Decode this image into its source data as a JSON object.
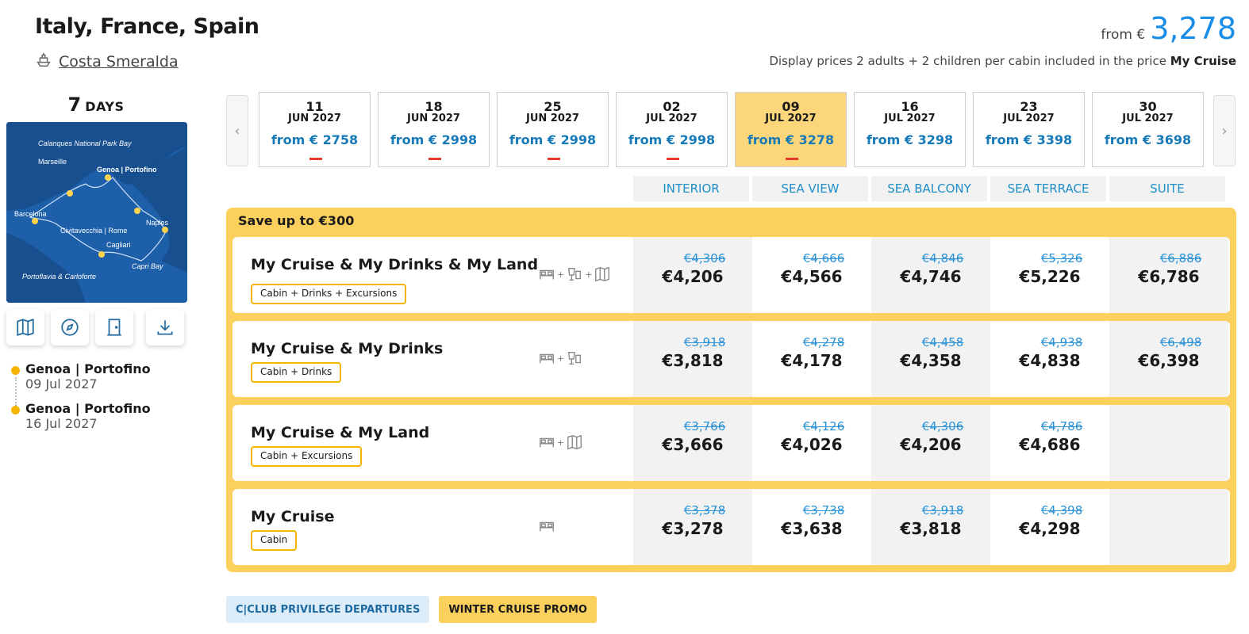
{
  "header": {
    "title": "Italy, France, Spain",
    "ship": "Costa Smeralda",
    "from_label": "from €",
    "price": "3,278",
    "note_prefix": "Display prices 2 adults + 2 children per cabin included in the price",
    "note_bold": "My Cruise"
  },
  "duration": {
    "number": "7",
    "unit": "DAYS"
  },
  "map": {
    "labels": [
      "Calanques National Park Bay",
      "Marseille",
      "Genoa | Portofino",
      "Barcelona",
      "Naples",
      "Civitavecchia | Rome",
      "Cagliari",
      "Capri Bay",
      "Portoflavia & Carloforte"
    ]
  },
  "map_actions": [
    "map-icon",
    "compass-icon",
    "door-icon",
    "download-icon"
  ],
  "itinerary": [
    {
      "port": "Genoa | Portofino",
      "date": "09 Jul 2027"
    },
    {
      "port": "Genoa | Portofino",
      "date": "16 Jul 2027"
    }
  ],
  "dates": [
    {
      "day": "11",
      "month": "JUN 2027",
      "price": "from € 2758",
      "dash": true,
      "selected": false
    },
    {
      "day": "18",
      "month": "JUN 2027",
      "price": "from € 2998",
      "dash": true,
      "selected": false
    },
    {
      "day": "25",
      "month": "JUN 2027",
      "price": "from € 2998",
      "dash": true,
      "selected": false
    },
    {
      "day": "02",
      "month": "JUL 2027",
      "price": "from € 2998",
      "dash": true,
      "selected": false
    },
    {
      "day": "09",
      "month": "JUL 2027",
      "price": "from € 3278",
      "dash": true,
      "selected": true
    },
    {
      "day": "16",
      "month": "JUL 2027",
      "price": "from € 3298",
      "dash": false,
      "selected": false
    },
    {
      "day": "23",
      "month": "JUL 2027",
      "price": "from € 3398",
      "dash": false,
      "selected": false
    },
    {
      "day": "30",
      "month": "JUL 2027",
      "price": "from € 3698",
      "dash": false,
      "selected": false
    }
  ],
  "categories": [
    "INTERIOR",
    "SEA VIEW",
    "SEA BALCONY",
    "SEA TERRACE",
    "SUITE"
  ],
  "offer": {
    "save": "Save up to €300",
    "rows": [
      {
        "name": "My Cruise & My Drinks & My Land",
        "tag": "Cabin + Drinks + Excursions",
        "prices": [
          [
            "€4,306",
            "€4,206"
          ],
          [
            "€4,666",
            "€4,566"
          ],
          [
            "€4,846",
            "€4,746"
          ],
          [
            "€5,326",
            "€5,226"
          ],
          [
            "€6,886",
            "€6,786"
          ]
        ]
      },
      {
        "name": "My Cruise & My Drinks",
        "tag": "Cabin + Drinks",
        "prices": [
          [
            "€3,918",
            "€3,818"
          ],
          [
            "€4,278",
            "€4,178"
          ],
          [
            "€4,458",
            "€4,358"
          ],
          [
            "€4,938",
            "€4,838"
          ],
          [
            "€6,498",
            "€6,398"
          ]
        ]
      },
      {
        "name": "My Cruise & My Land",
        "tag": "Cabin + Excursions",
        "prices": [
          [
            "€3,766",
            "€3,666"
          ],
          [
            "€4,126",
            "€4,026"
          ],
          [
            "€4,306",
            "€4,206"
          ],
          [
            "€4,786",
            "€4,686"
          ],
          [
            "",
            ""
          ]
        ]
      },
      {
        "name": "My Cruise",
        "tag": "Cabin",
        "prices": [
          [
            "€3,378",
            "€3,278"
          ],
          [
            "€3,738",
            "€3,638"
          ],
          [
            "€3,918",
            "€3,818"
          ],
          [
            "€4,398",
            "€4,298"
          ],
          [
            "",
            ""
          ]
        ]
      }
    ]
  },
  "badges": [
    "C|CLUB PRIVILEGE DEPARTURES",
    "WINTER CRUISE PROMO"
  ]
}
